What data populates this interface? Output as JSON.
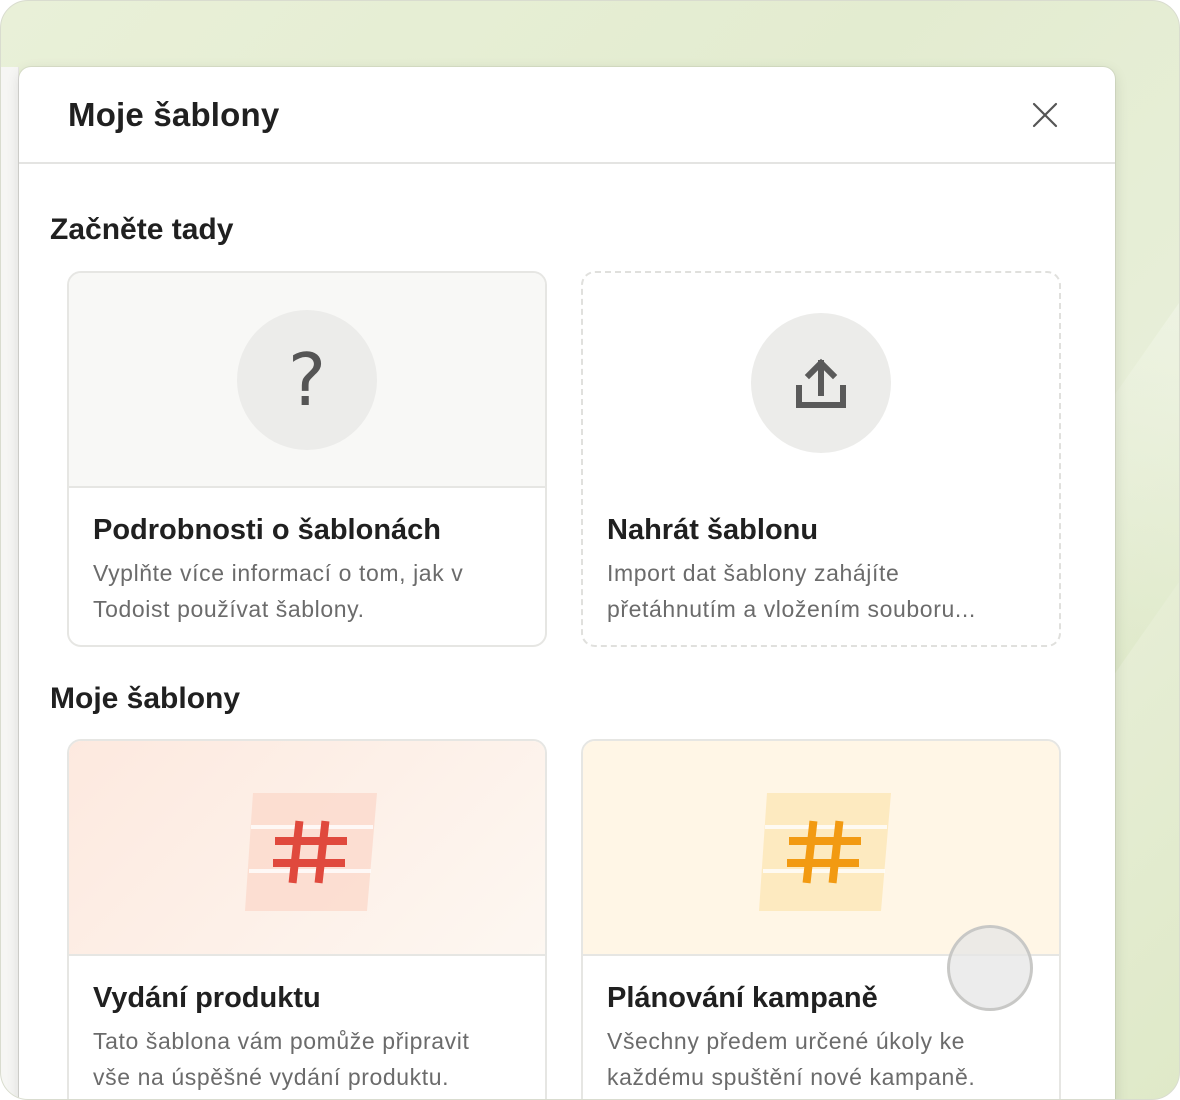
{
  "modal": {
    "title": "Moje šablony"
  },
  "start_section": {
    "title": "Začněte tady",
    "cards": [
      {
        "title": "Podrobnosti o šablonách",
        "description_lines": [
          "Vyplňte více informací o tom, jak v",
          "Todoist používat šablony."
        ],
        "icon": "question-mark-icon"
      },
      {
        "title": "Nahrát šablonu",
        "description_lines": [
          "Import dat šablony zahájíte",
          "přetáhnutím a vložením souboru..."
        ],
        "icon": "upload-icon"
      }
    ]
  },
  "my_section": {
    "title": "Moje šablony",
    "cards": [
      {
        "title": "Vydání produktu",
        "description_lines": [
          "Tato šablona vám pomůže připravit",
          "vše na úspěšné vydání produktu."
        ],
        "icon": "hashtag-icon",
        "accent": "#e0493d"
      },
      {
        "title": "Plánování kampaně",
        "description_lines": [
          "Všechny předem určené úkoly ke",
          "každému spuštění nové kampaně."
        ],
        "icon": "hashtag-icon",
        "accent": "#f29a12"
      }
    ]
  }
}
